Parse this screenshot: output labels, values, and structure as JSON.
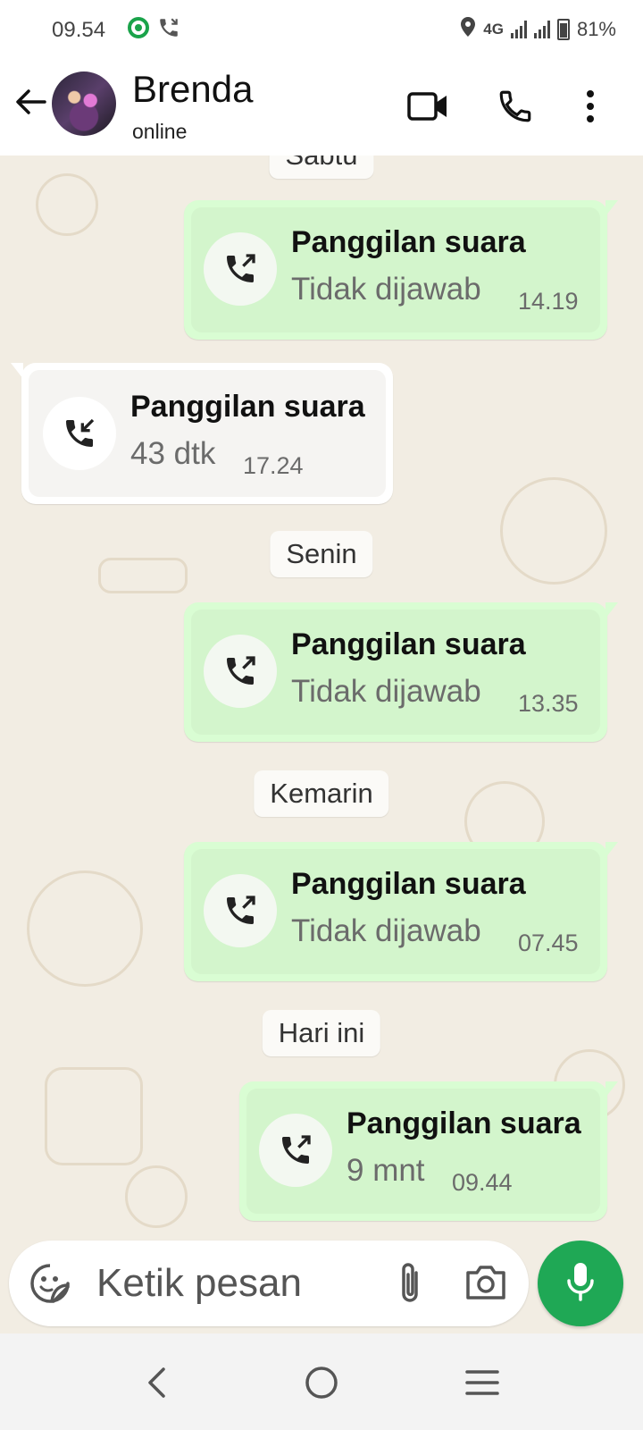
{
  "status_bar": {
    "time": "09.54",
    "network": "4G",
    "battery": "81%"
  },
  "header": {
    "contact_name": "Brenda",
    "contact_status": "online"
  },
  "chat": {
    "date_labels": [
      "Sabtu",
      "Senin",
      "Kemarin",
      "Hari ini"
    ],
    "messages": [
      {
        "direction": "outgoing",
        "title": "Panggilan suara",
        "subtitle": "Tidak dijawab",
        "time": "14.19",
        "icon": "outgoing-call-icon"
      },
      {
        "direction": "incoming",
        "title": "Panggilan suara",
        "subtitle": "43 dtk",
        "time": "17.24",
        "icon": "incoming-call-icon"
      },
      {
        "direction": "outgoing",
        "title": "Panggilan suara",
        "subtitle": "Tidak dijawab",
        "time": "13.35",
        "icon": "outgoing-call-icon"
      },
      {
        "direction": "outgoing",
        "title": "Panggilan suara",
        "subtitle": "Tidak dijawab",
        "time": "07.45",
        "icon": "outgoing-call-icon"
      },
      {
        "direction": "outgoing",
        "title": "Panggilan suara",
        "subtitle": "9 mnt",
        "time": "09.44",
        "icon": "outgoing-call-icon"
      }
    ]
  },
  "composer": {
    "placeholder": "Ketik pesan"
  },
  "colors": {
    "outgoing_bubble": "#d9fdd3",
    "incoming_bubble": "#ffffff",
    "chat_background": "#f2ede3",
    "mic_button": "#1fa855"
  }
}
